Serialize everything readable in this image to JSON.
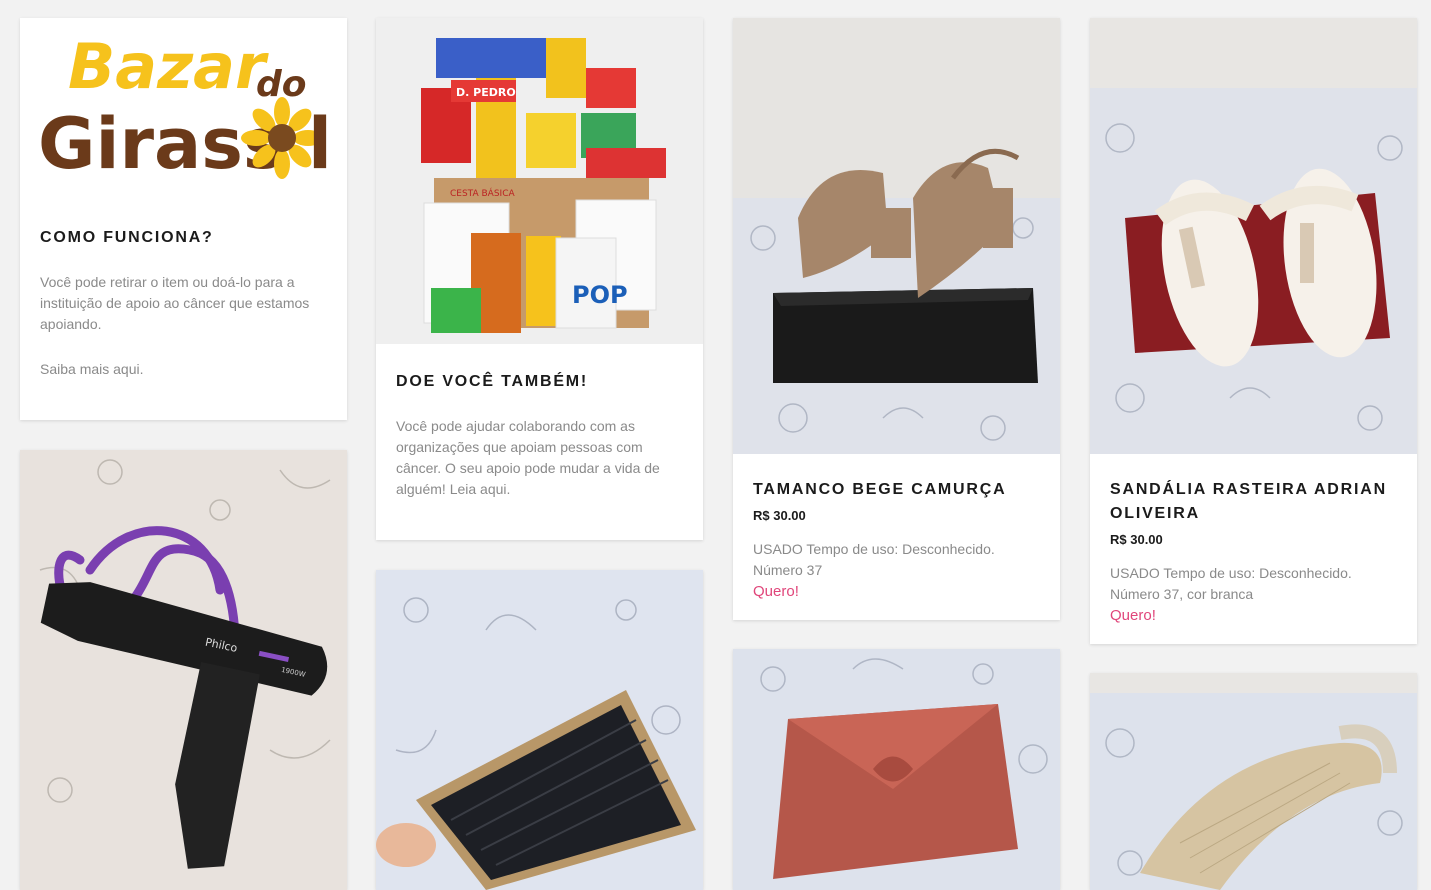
{
  "info_cards": [
    {
      "logo_text_line1": "Bazar",
      "logo_text_do": "do",
      "logo_text_line2": "Girass",
      "logo_text_end": "l",
      "title": "COMO FUNCIONA?",
      "text": "Você pode retirar o item ou doá-lo para a instituição de apoio ao câncer que estamos apoiando.",
      "link": "Saiba mais aqui."
    },
    {
      "title": "DOE VOCÊ TAMBÉM!",
      "text": "Você pode ajudar colaborando com as organizações que apoiam pessoas com câncer. O seu apoio pode mudar a vida de alguém! Leia aqui."
    }
  ],
  "products": [
    {
      "title": "TAMANCO BEGE CAMURÇA",
      "price": "R$ 30.00",
      "description": "USADO Tempo de uso: Desconhecido. Número 37",
      "cta": "Quero!"
    },
    {
      "title": "SANDÁLIA RASTEIRA ADRIAN OLIVEIRA",
      "price": "R$ 30.00",
      "description": "USADO Tempo de uso: Desconhecido. Número 37, cor branca",
      "cta": "Quero!"
    }
  ],
  "image_labels": {
    "basket_box": "CESTA BÁSICA",
    "basket_pop": "POP",
    "basket_dpedro": "D. PEDRO",
    "dryer_brand": "Philco",
    "dryer_watts": "1900W"
  },
  "colors": {
    "accent": "#e0457a",
    "background": "#f2f2f2",
    "logo_yellow": "#f6c21c",
    "logo_brown": "#6b3a1a"
  }
}
